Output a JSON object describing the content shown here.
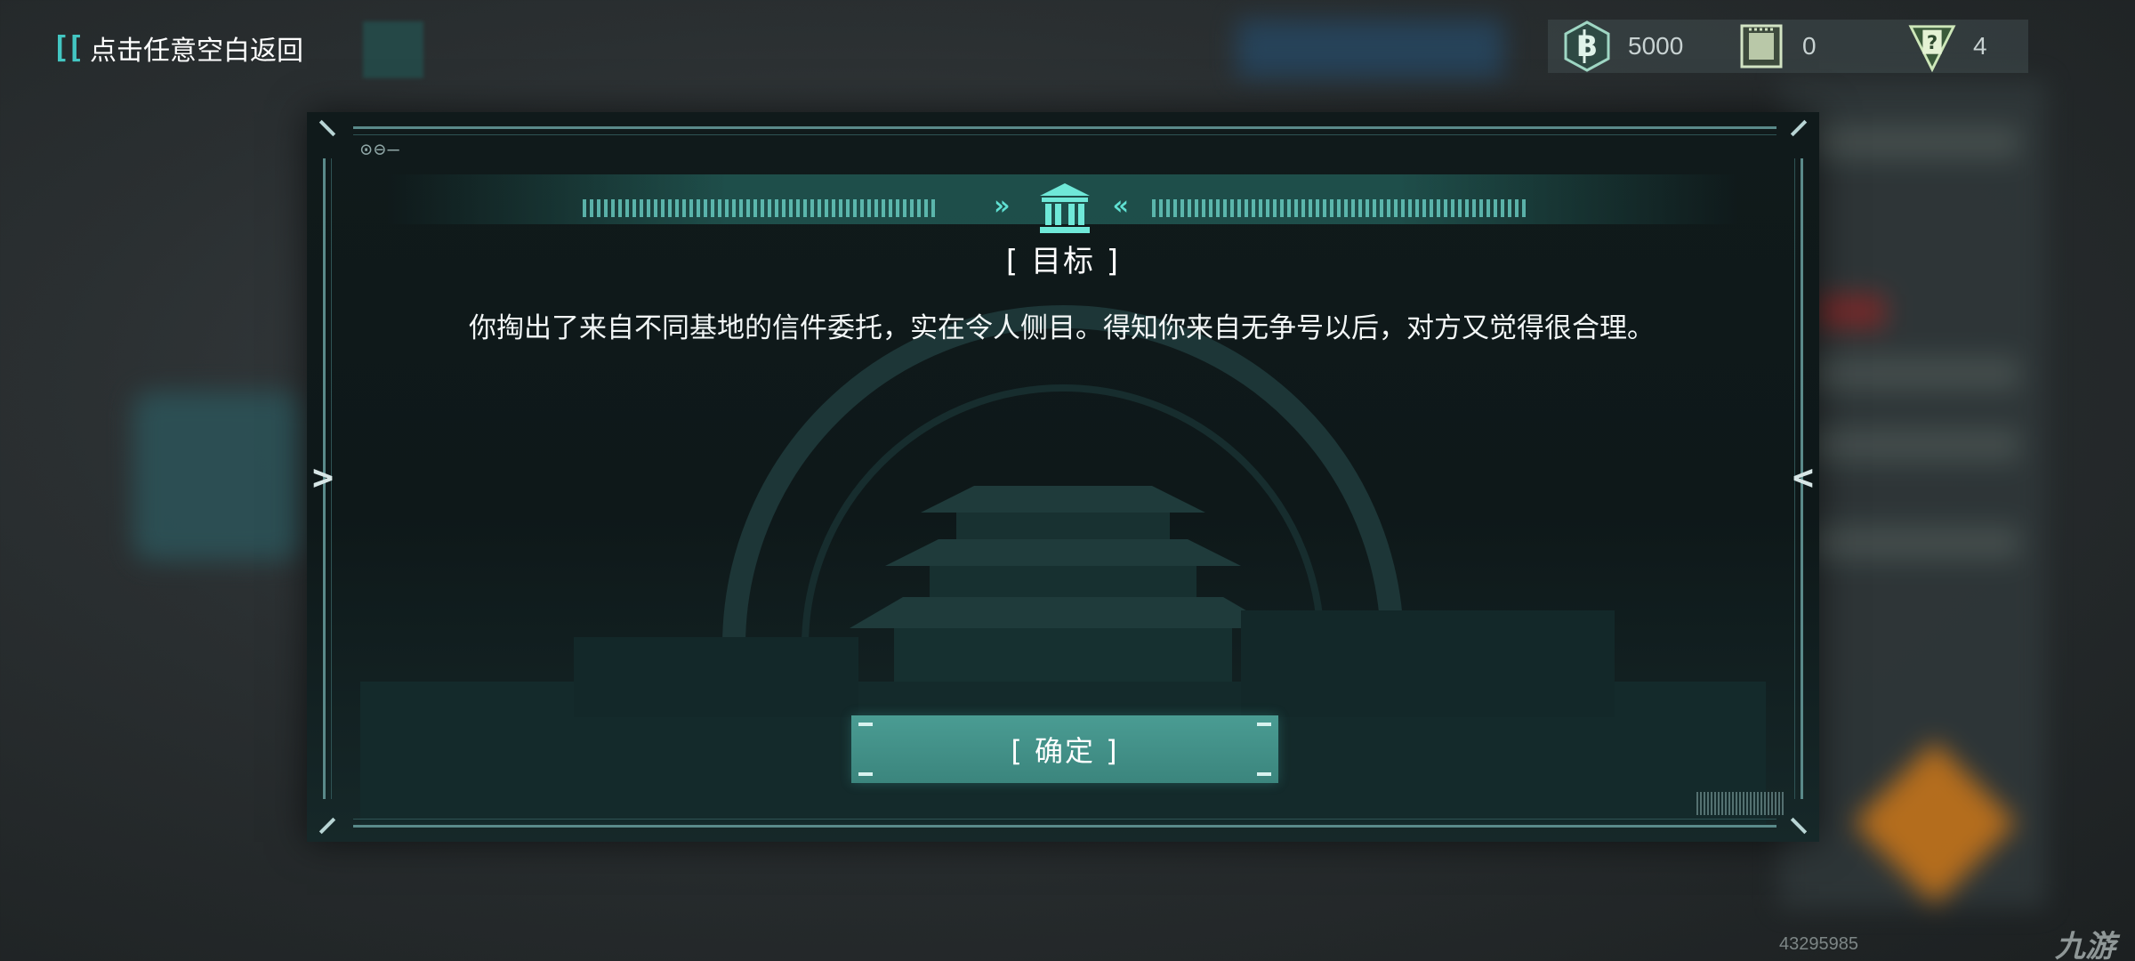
{
  "top_bar": {
    "back_hint_icon": "double-bracket-icon",
    "back_hint": "点击任意空白返回",
    "currencies": [
      {
        "icon": "coin-b-icon",
        "value": "5000"
      },
      {
        "icon": "ticket-icon",
        "value": "0"
      },
      {
        "icon": "question-card-icon",
        "value": "4"
      }
    ]
  },
  "dialog": {
    "header_icon": "bank-building-icon",
    "corner_label": "⊙⊖—",
    "title": "[ 目标 ]",
    "body": "你掏出了来自不同基地的信件委托，实在令人侧目。得知你来自无争号以后，对方又觉得很合理。",
    "confirm_label": "[ 确定 ]"
  },
  "watermark": {
    "id": "43295985",
    "logo": "九游"
  },
  "colors": {
    "accent": "#43c6c2",
    "button": "#3f8f86",
    "panel": "#0f191a"
  }
}
